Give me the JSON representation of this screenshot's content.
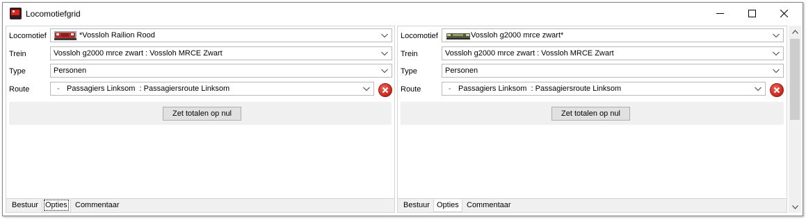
{
  "window": {
    "title": "Locomotiefgrid"
  },
  "labels": {
    "locomotief": "Locomotief",
    "trein": "Trein",
    "type": "Type",
    "route": "Route"
  },
  "panes": [
    {
      "locomotief": "*Vossloh Railion Rood",
      "trein": "Vossloh g2000 mrce zwart : Vossloh MRCE Zwart",
      "type": "Personen",
      "route_bullet": "-",
      "route": "Passagiers Linksom  : Passagiersroute Linksom",
      "reset_label": "Zet totalen op nul",
      "tabs": [
        "Bestuur",
        "Opties",
        "Commentaar"
      ],
      "active_tab": "Opties"
    },
    {
      "locomotief": "Vossloh g2000 mrce zwart*",
      "trein": "Vossloh g2000 mrce zwart : Vossloh MRCE Zwart",
      "type": "Personen",
      "route_bullet": "-",
      "route": "Passagiers Linksom  : Passagiersroute Linksom",
      "reset_label": "Zet totalen op nul",
      "tabs": [
        "Bestuur",
        "Opties",
        "Commentaar"
      ],
      "active_tab": "Opties"
    }
  ],
  "colors": {
    "delete": "#d9342a",
    "panel": "#f0f0f0",
    "loco_left": "#b2302b",
    "loco_right": "#4f5a3a"
  },
  "icons": [
    "locomotive-app-icon",
    "minimize-icon",
    "maximize-icon",
    "close-icon",
    "chevron-down-icon",
    "delete-icon",
    "scroll-up-icon",
    "scroll-down-icon"
  ]
}
